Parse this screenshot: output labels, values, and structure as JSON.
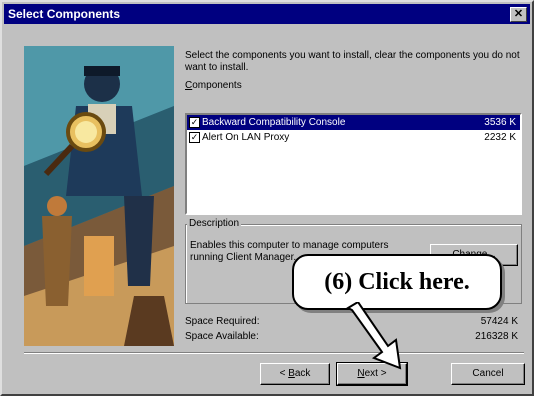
{
  "window": {
    "title": "Select Components",
    "close_glyph": "✕"
  },
  "intro_text": "Select the components you want to install, clear the components you do not want to install.",
  "components": {
    "label_accel": "C",
    "label_rest": "omponents",
    "items": [
      {
        "name": "Backward Compatibility Console",
        "size": "3536 K",
        "checked": true,
        "selected": true
      },
      {
        "name": "Alert On LAN Proxy",
        "size": "2232 K",
        "checked": true,
        "selected": false
      }
    ]
  },
  "description": {
    "legend": "Description",
    "text": "Enables this computer to manage computers running Client Manager.",
    "change_button": "Change..."
  },
  "space": {
    "required_label": "Space Required:",
    "required_value": "57424 K",
    "available_label": "Space Available:",
    "available_value": "216328 K"
  },
  "buttons": {
    "back_pre": "< ",
    "back_accel": "B",
    "back_post": "ack",
    "next_accel": "N",
    "next_post": "ext >",
    "cancel": "Cancel"
  },
  "annotation": {
    "callout_text": "(6)  Click here."
  },
  "colors": {
    "titlebar": "#000080",
    "face": "#c0c0c0",
    "selection": "#000080"
  }
}
